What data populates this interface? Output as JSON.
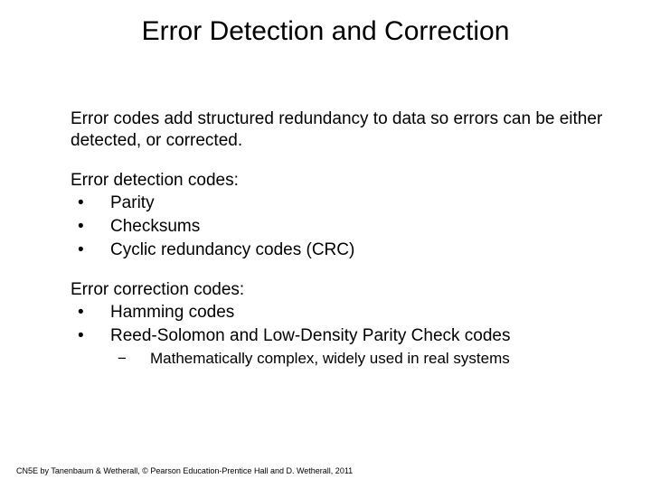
{
  "title": "Error Detection and Correction",
  "intro": "Error codes add structured redundancy to data so errors can be either detected, or corrected.",
  "detection": {
    "heading": "Error detection codes:",
    "items": [
      "Parity",
      "Checksums",
      "Cyclic redundancy codes (CRC)"
    ]
  },
  "correction": {
    "heading": "Error correction codes:",
    "items": [
      "Hamming codes",
      "Reed-Solomon and Low-Density Parity Check codes"
    ],
    "subitems": [
      "Mathematically complex, widely used in real systems"
    ]
  },
  "footer": "CN5E by Tanenbaum & Wetherall, © Pearson Education-Prentice Hall and D. Wetherall, 2011"
}
